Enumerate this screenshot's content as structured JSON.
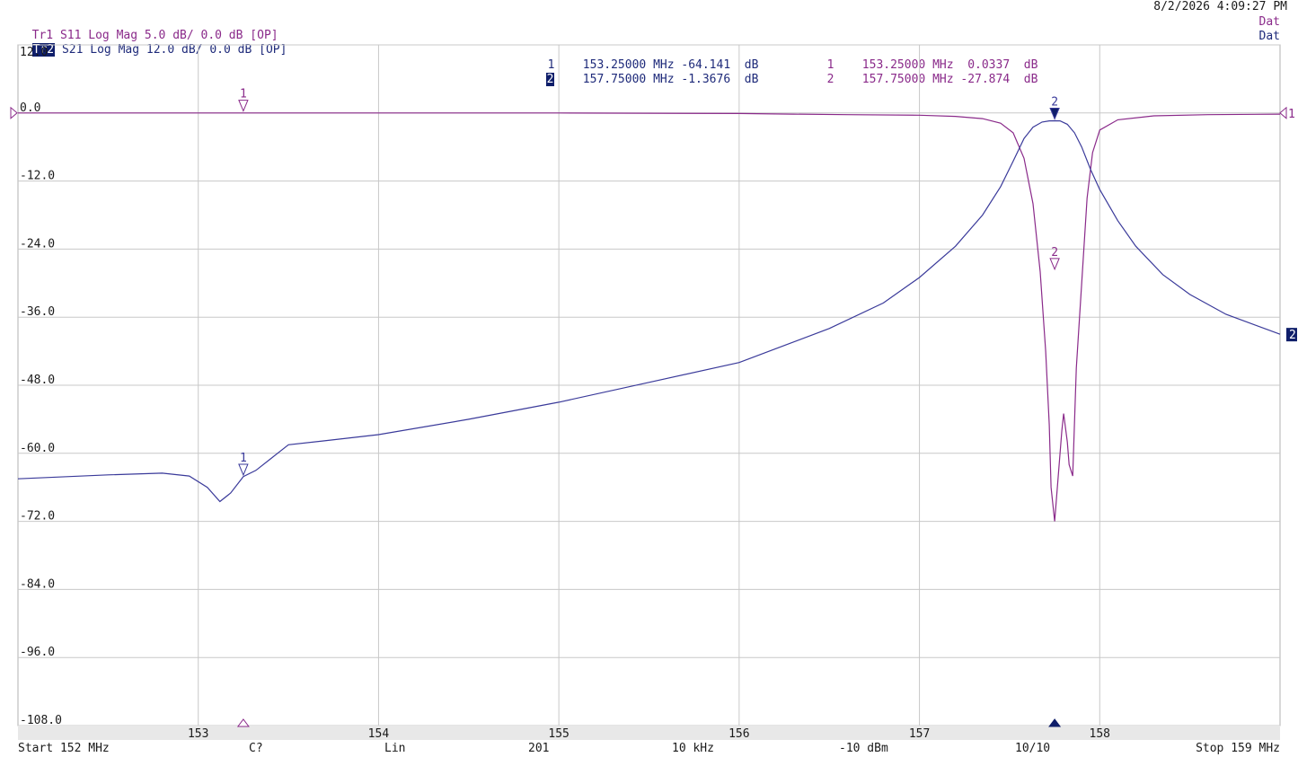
{
  "header": {
    "timestamp": "8/2/2026 4:09:27 PM",
    "trace1": {
      "id": "Tr1",
      "desc": "S11 Log Mag 5.0 dB/ 0.0 dB [OP]",
      "status": "Dat"
    },
    "trace2": {
      "id": "Tr2",
      "desc": "S21 Log Mag 12.0 dB/ 0.0 dB [OP]",
      "status": "Dat"
    }
  },
  "markers_table": {
    "trace2": [
      {
        "num": "1",
        "text": "153.25000 MHz -64.141  dB"
      },
      {
        "num": "2",
        "text": "157.75000 MHz -1.3676  dB"
      }
    ],
    "trace1": [
      {
        "num": "1",
        "text": "153.25000 MHz  0.0337  dB"
      },
      {
        "num": "2",
        "text": "157.75000 MHz -27.874  dB"
      }
    ]
  },
  "footer": {
    "start": "Start 152 MHz",
    "cal": "C?",
    "sweep": "Lin",
    "points": "201",
    "ifbw": "10 kHz",
    "power": "-10 dBm",
    "avg": "10/10",
    "stop": "Stop 159 MHz"
  },
  "right_tags": {
    "trace1": "1",
    "trace2": "2"
  },
  "colors": {
    "s11": "#8a2a8a",
    "s21": "#3a3a9a",
    "grid": "#c8c8c8",
    "tag": "#0f1e6a"
  },
  "chart_data": {
    "type": "line",
    "xlabel": "",
    "ylabel": "",
    "x_ticks": [
      153,
      154,
      155,
      156,
      157,
      158
    ],
    "x_tick_labels": [
      "153",
      "154",
      "155",
      "156",
      "157",
      "158"
    ],
    "y_ticks": [
      12,
      0,
      -12,
      -24,
      -36,
      -48,
      -60,
      -72,
      -84,
      -96,
      -108
    ],
    "y_tick_labels": [
      "12.0",
      "0.0",
      "-12.0",
      "-24.0",
      "-36.0",
      "-48.0",
      "-60.0",
      "-72.0",
      "-84.0",
      "-96.0",
      "-108.0"
    ],
    "xlim": [
      152,
      159
    ],
    "ylim": [
      -108,
      12
    ],
    "grid": true,
    "series": [
      {
        "name": "S11",
        "color": "#8a2a8a",
        "x": [
          152,
          153,
          154,
          155,
          156,
          156.3,
          156.6,
          157,
          157.2,
          157.35,
          157.45,
          157.52,
          157.58,
          157.63,
          157.67,
          157.7,
          157.72,
          157.73,
          157.75,
          157.77,
          157.79,
          157.8,
          157.82,
          157.83,
          157.85,
          157.87,
          157.9,
          157.93,
          157.96,
          158,
          158.1,
          158.3,
          158.6,
          159
        ],
        "y": [
          0,
          0,
          0,
          0,
          -0.1,
          -0.2,
          -0.3,
          -0.4,
          -0.6,
          -1.0,
          -1.8,
          -3.5,
          -8,
          -16,
          -28,
          -42,
          -55,
          -66,
          -72,
          -64,
          -56,
          -53,
          -58,
          -62,
          -64,
          -45,
          -30,
          -15,
          -7,
          -3,
          -1.2,
          -0.5,
          -0.3,
          -0.2
        ]
      },
      {
        "name": "S21",
        "color": "#3a3a9a",
        "x": [
          152,
          152.5,
          152.8,
          152.95,
          153.05,
          153.12,
          153.18,
          153.25,
          153.32,
          153.4,
          153.5,
          153.7,
          154,
          154.5,
          155,
          155.5,
          156,
          156.5,
          156.8,
          157,
          157.2,
          157.35,
          157.45,
          157.52,
          157.58,
          157.63,
          157.68,
          157.72,
          157.75,
          157.78,
          157.82,
          157.86,
          157.9,
          157.95,
          158,
          158.1,
          158.2,
          158.35,
          158.5,
          158.7,
          159
        ],
        "y": [
          -64.5,
          -63.8,
          -63.5,
          -64,
          -66,
          -68.5,
          -67,
          -64.1,
          -63,
          -61,
          -58.5,
          -57.8,
          -56.7,
          -54,
          -51,
          -47.5,
          -44,
          -38,
          -33.5,
          -29,
          -23.5,
          -18,
          -13,
          -8.5,
          -4.5,
          -2.5,
          -1.6,
          -1.4,
          -1.37,
          -1.4,
          -2,
          -3.5,
          -6,
          -10,
          -13.5,
          -19,
          -23.5,
          -28.5,
          -32,
          -35.5,
          -39
        ]
      }
    ],
    "markers": [
      {
        "trace": "S11",
        "num": "1",
        "x": 153.25,
        "y": 0.0337
      },
      {
        "trace": "S11",
        "num": "2",
        "x": 157.75,
        "y": -27.874
      },
      {
        "trace": "S21",
        "num": "1",
        "x": 153.25,
        "y": -64.141
      },
      {
        "trace": "S21",
        "num": "2",
        "x": 157.75,
        "y": -1.3676
      }
    ]
  }
}
